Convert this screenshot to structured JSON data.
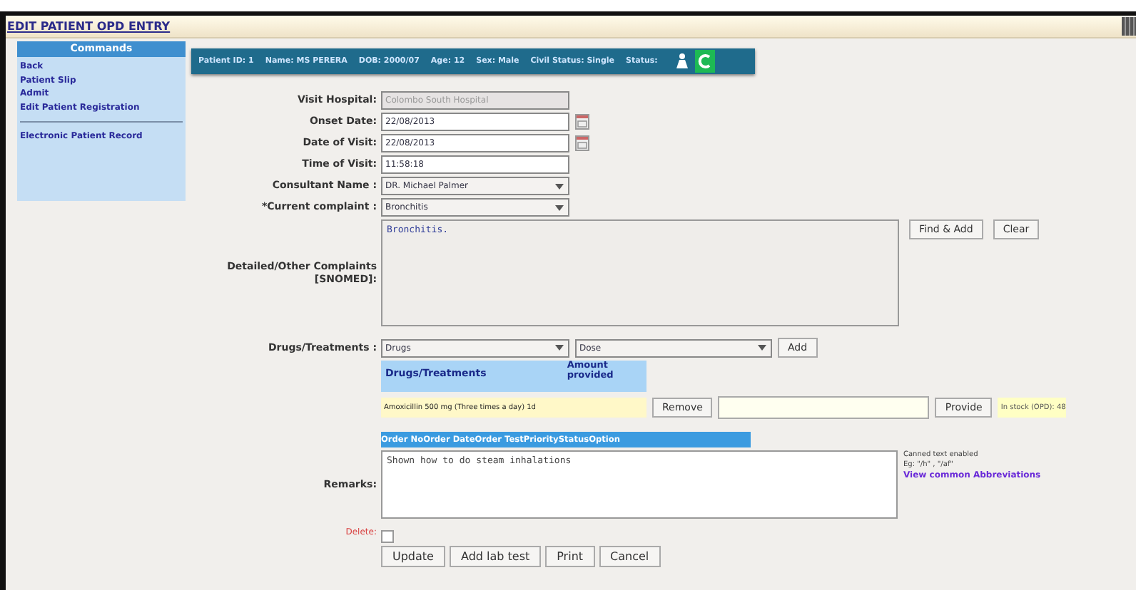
{
  "window": {
    "title": "EDIT PATIENT OPD ENTRY"
  },
  "sidebar": {
    "title": "Commands",
    "groups": [
      [
        "Back",
        "Patient Slip",
        "Admit",
        "Edit Patient Registration"
      ],
      [
        "Electronic Patient Record"
      ]
    ]
  },
  "patient_bar": [
    "Patient ID: 1",
    "Name: MS PERERA",
    "DOB: 2000/07",
    "Age: 12",
    "Sex: Male",
    "Civil Status: Single",
    "Status:"
  ],
  "fields": [
    {
      "label": "Visit Hospital:",
      "kind": "text",
      "value": "Colombo South Hospital",
      "disabled": true
    },
    {
      "label": "Onset Date:",
      "kind": "date",
      "value": "22/08/2013",
      "disabled": false
    },
    {
      "label": "Date of Visit:",
      "kind": "date",
      "value": "22/08/2013",
      "disabled": false
    },
    {
      "label": "Time of Visit:",
      "kind": "text",
      "value": "11:58:18",
      "disabled": false
    },
    {
      "label": "Consultant Name :",
      "kind": "select",
      "value": "DR. Michael Palmer",
      "disabled": false
    },
    {
      "label": "*Current complaint :",
      "kind": "select",
      "value": "Bronchitis",
      "disabled": false
    }
  ],
  "complaints": {
    "label": "Detailed/Other Complaints [SNOMED]:",
    "value": "Bronchitis.",
    "buttons": [
      "Find & Add",
      "Clear"
    ]
  },
  "drugs": {
    "label": "Drugs/Treatments :",
    "drug": "Drugs",
    "dose": "Dose",
    "add": "Add",
    "columns": [
      "Drugs/Treatments",
      "Amount provided"
    ],
    "rows": [
      {
        "name": "Amoxicillin 500 mg (Three times a day) 1d",
        "remove": "Remove",
        "provide": "Provide",
        "stock": "In stock (OPD): 48"
      }
    ]
  },
  "orders": {
    "columns": [
      "Order No",
      "Order Date",
      "Order Test",
      "Priority",
      "Status",
      "Option"
    ]
  },
  "remarks": {
    "label": "Remarks:",
    "value": "Shown how to do steam inhalations",
    "hint": "Canned text enabled",
    "example": "Eg: \"/h\" , \"/af\"",
    "link": "View common Abbreviations"
  },
  "delete": {
    "label": "Delete:",
    "checked": false
  },
  "buttons": [
    "Update",
    "Add lab test",
    "Print",
    "Cancel"
  ]
}
